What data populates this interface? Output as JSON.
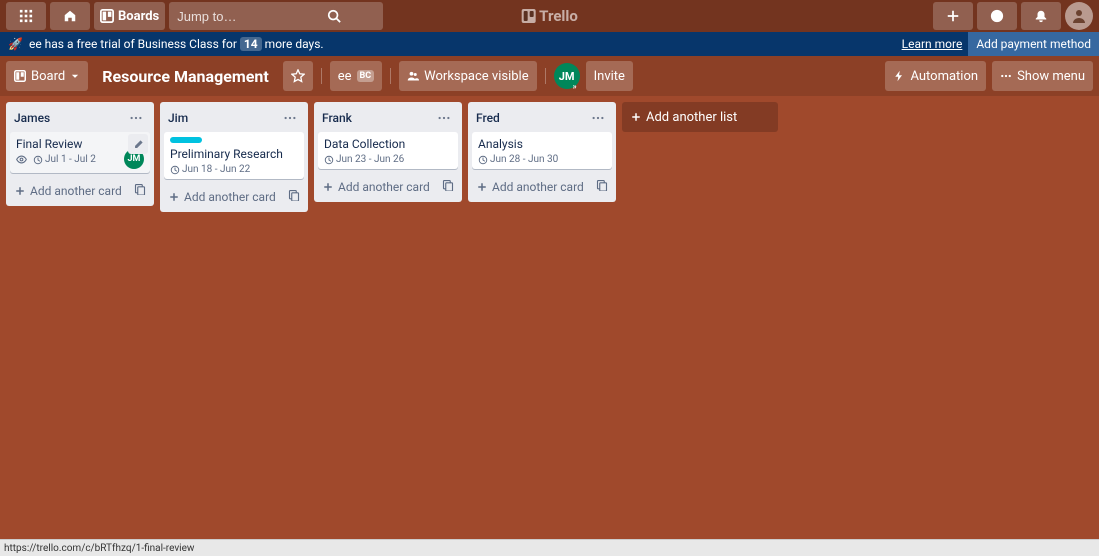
{
  "topbar": {
    "boards_label": "Boards",
    "search_placeholder": "Jump to…",
    "app_name": "Trello"
  },
  "banner": {
    "text_a": "ee has a free trial of Business Class for",
    "days": "14",
    "text_b": "more days.",
    "learn_more": "Learn more",
    "add_payment": "Add payment method"
  },
  "boardbar": {
    "board_switch": "Board",
    "board_name": "Resource Management",
    "workspace_short": "ee",
    "bc_badge": "BC",
    "visibility": "Workspace visible",
    "member_initials": "JM",
    "invite": "Invite",
    "automation": "Automation",
    "show_menu": "Show menu"
  },
  "lists": [
    {
      "title": "James",
      "cards": [
        {
          "title": "Final Review",
          "date": "Jul 1 - Jul 2",
          "watch": true,
          "hover": true,
          "member": "JM"
        }
      ]
    },
    {
      "title": "Jim",
      "cards": [
        {
          "title": "Preliminary Research",
          "date": "Jun 18 - Jun 22",
          "label_color": "#00c2e0"
        }
      ]
    },
    {
      "title": "Frank",
      "cards": [
        {
          "title": "Data Collection",
          "date": "Jun 23 - Jun 26"
        }
      ]
    },
    {
      "title": "Fred",
      "cards": [
        {
          "title": "Analysis",
          "date": "Jun 28 - Jun 30"
        }
      ]
    }
  ],
  "add_card_label": "Add another card",
  "add_list_label": "Add another list",
  "status_url": "https://trello.com/c/bRTfhzq/1-final-review"
}
